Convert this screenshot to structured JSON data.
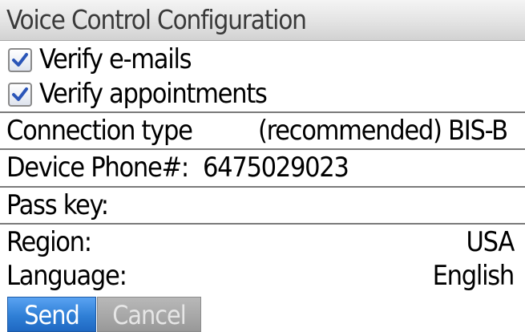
{
  "screen": {
    "title": "Voice Control Configuration"
  },
  "options": [
    {
      "label": "Verify e-mails",
      "checked": true
    },
    {
      "label": "Verify appointments",
      "checked": true
    }
  ],
  "connection": {
    "label": "Connection type",
    "value": "(recommended) BIS-B"
  },
  "phone": {
    "label": "Device Phone#:",
    "value": "6475029023"
  },
  "passkey": {
    "label": "Pass key:",
    "value": ""
  },
  "region": {
    "label": "Region:",
    "value": "USA"
  },
  "language": {
    "label": "Language:",
    "value": "English"
  },
  "buttons": {
    "send_label": "Send",
    "cancel_label": "Cancel"
  },
  "colors": {
    "checkmark": "#2a55b8",
    "send_button": "#2f7fd6",
    "cancel_button": "#a6a6a6",
    "divider": "#7a7a7a"
  },
  "icons": {
    "checkbox": "checkbox-checked-icon"
  }
}
